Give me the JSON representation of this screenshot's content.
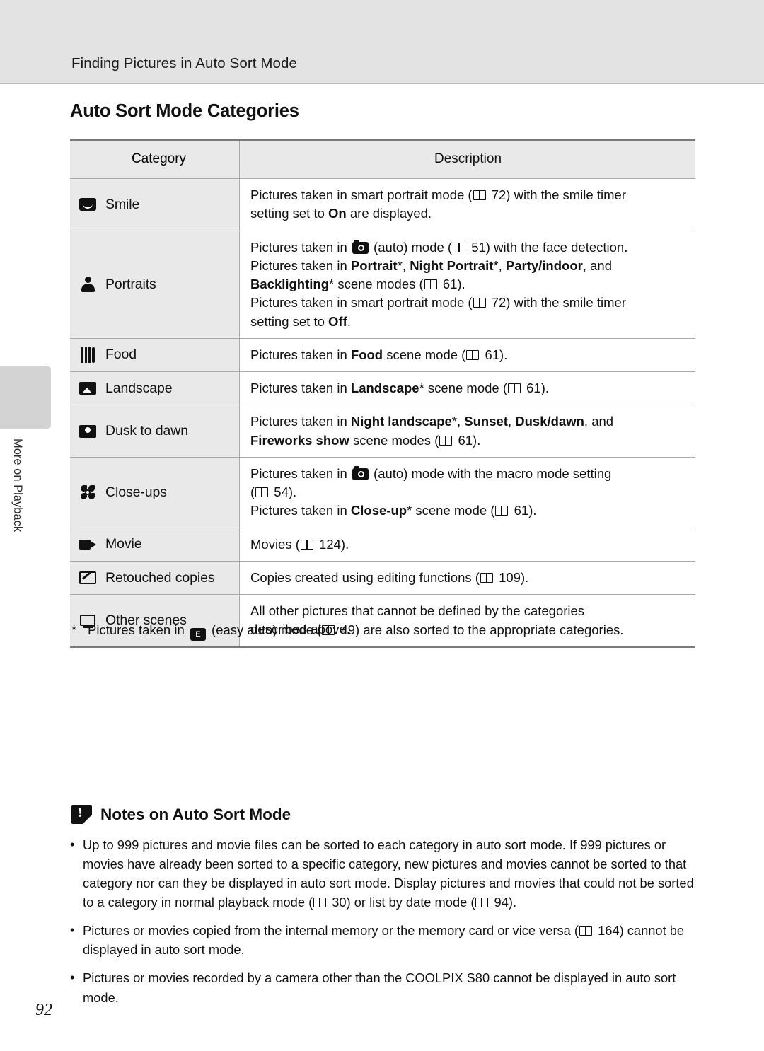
{
  "header": {
    "title": "Finding Pictures in Auto Sort Mode"
  },
  "side_tab": {
    "label": "More on Playback"
  },
  "section": {
    "title": "Auto Sort Mode Categories"
  },
  "table": {
    "headers": {
      "category": "Category",
      "description": "Description"
    },
    "rows": [
      {
        "icon": "smile-icon",
        "category": "Smile",
        "lines": [
          {
            "parts": [
              {
                "t": "Pictures taken in smart portrait mode ("
              },
              {
                "t": "book-icon",
                "type": "icon"
              },
              {
                "t": " 72) with the smile timer"
              }
            ]
          },
          {
            "parts": [
              {
                "t": "setting set to "
              },
              {
                "t": "On",
                "bold": true
              },
              {
                "t": " are displayed."
              }
            ]
          }
        ]
      },
      {
        "icon": "portrait-icon",
        "category": "Portraits",
        "lines": [
          {
            "parts": [
              {
                "t": "Pictures taken in "
              },
              {
                "t": "camera-auto-icon",
                "type": "icon"
              },
              {
                "t": " (auto) mode ("
              },
              {
                "t": "book-icon",
                "type": "icon"
              },
              {
                "t": " 51) with the face detection."
              }
            ]
          },
          {
            "parts": [
              {
                "t": "Pictures taken in "
              },
              {
                "t": "Portrait",
                "bold": true
              },
              {
                "t": "*, "
              },
              {
                "t": "Night Portrait",
                "bold": true
              },
              {
                "t": "*, "
              },
              {
                "t": "Party/indoor",
                "bold": true
              },
              {
                "t": ", and"
              }
            ]
          },
          {
            "parts": [
              {
                "t": "Backlighting",
                "bold": true
              },
              {
                "t": "* scene modes ("
              },
              {
                "t": "book-icon",
                "type": "icon"
              },
              {
                "t": " 61)."
              }
            ]
          },
          {
            "parts": [
              {
                "t": "Pictures taken in smart portrait mode ("
              },
              {
                "t": "book-icon",
                "type": "icon"
              },
              {
                "t": " 72) with the smile timer"
              }
            ]
          },
          {
            "parts": [
              {
                "t": "setting set to "
              },
              {
                "t": "Off",
                "bold": true
              },
              {
                "t": "."
              }
            ]
          }
        ]
      },
      {
        "icon": "food-icon",
        "category": "Food",
        "lines": [
          {
            "parts": [
              {
                "t": "Pictures taken in "
              },
              {
                "t": "Food",
                "bold": true
              },
              {
                "t": " scene mode ("
              },
              {
                "t": "book-icon",
                "type": "icon"
              },
              {
                "t": " 61)."
              }
            ]
          }
        ]
      },
      {
        "icon": "landscape-icon",
        "category": "Landscape",
        "lines": [
          {
            "parts": [
              {
                "t": "Pictures taken in "
              },
              {
                "t": "Landscape",
                "bold": true
              },
              {
                "t": "* scene mode ("
              },
              {
                "t": "book-icon",
                "type": "icon"
              },
              {
                "t": " 61)."
              }
            ]
          }
        ]
      },
      {
        "icon": "dusk-to-dawn-icon",
        "category": "Dusk to dawn",
        "lines": [
          {
            "parts": [
              {
                "t": "Pictures taken in "
              },
              {
                "t": "Night landscape",
                "bold": true
              },
              {
                "t": "*, "
              },
              {
                "t": "Sunset",
                "bold": true
              },
              {
                "t": ", "
              },
              {
                "t": "Dusk/dawn",
                "bold": true
              },
              {
                "t": ", and"
              }
            ]
          },
          {
            "parts": [
              {
                "t": "Fireworks show",
                "bold": true
              },
              {
                "t": " scene modes ("
              },
              {
                "t": "book-icon",
                "type": "icon"
              },
              {
                "t": " 61)."
              }
            ]
          }
        ]
      },
      {
        "icon": "close-ups-icon",
        "category": "Close-ups",
        "lines": [
          {
            "parts": [
              {
                "t": "Pictures taken in "
              },
              {
                "t": "camera-auto-icon",
                "type": "icon"
              },
              {
                "t": " (auto) mode with the macro mode setting"
              }
            ]
          },
          {
            "parts": [
              {
                "t": "("
              },
              {
                "t": "book-icon",
                "type": "icon"
              },
              {
                "t": " 54)."
              }
            ]
          },
          {
            "parts": [
              {
                "t": "Pictures taken in "
              },
              {
                "t": "Close-up",
                "bold": true
              },
              {
                "t": "* scene mode ("
              },
              {
                "t": "book-icon",
                "type": "icon"
              },
              {
                "t": " 61)."
              }
            ]
          }
        ]
      },
      {
        "icon": "movie-icon",
        "category": "Movie",
        "lines": [
          {
            "parts": [
              {
                "t": "Movies ("
              },
              {
                "t": "book-icon",
                "type": "icon"
              },
              {
                "t": " 124)."
              }
            ]
          }
        ]
      },
      {
        "icon": "retouched-copies-icon",
        "category": "Retouched copies",
        "lines": [
          {
            "parts": [
              {
                "t": "Copies created using editing functions ("
              },
              {
                "t": "book-icon",
                "type": "icon"
              },
              {
                "t": " 109)."
              }
            ]
          }
        ]
      },
      {
        "icon": "other-scenes-icon",
        "category": "Other scenes",
        "lines": [
          {
            "parts": [
              {
                "t": "All other pictures that cannot be defined by the categories"
              }
            ]
          },
          {
            "parts": [
              {
                "t": "described above."
              }
            ]
          }
        ]
      }
    ]
  },
  "footnote": {
    "marker": "*",
    "parts": [
      {
        "t": "Pictures taken in "
      },
      {
        "t": "easy-auto-icon",
        "type": "icon"
      },
      {
        "t": " (easy auto) mode ("
      },
      {
        "t": "book-icon",
        "type": "icon"
      },
      {
        "t": " 49) are also sorted to the appropriate categories."
      }
    ]
  },
  "notes": {
    "icon": "caution-icon",
    "title": "Notes on Auto Sort Mode",
    "bullets": [
      {
        "marker": "•",
        "parts": [
          {
            "t": "Up to 999 pictures and movie files can be sorted to each category in auto sort mode. If 999 pictures or movies have already been sorted to a specific category, new pictures and movies cannot be sorted to that category nor can they be displayed in auto sort mode. Display pictures and movies that could not be sorted to a category in normal playback mode ("
          },
          {
            "t": "book-icon",
            "type": "icon"
          },
          {
            "t": " 30) or list by date mode ("
          },
          {
            "t": "book-icon",
            "type": "icon"
          },
          {
            "t": " 94)."
          }
        ]
      },
      {
        "marker": "•",
        "parts": [
          {
            "t": "Pictures or movies copied from the internal memory or the memory card or vice versa ("
          },
          {
            "t": "book-icon",
            "type": "icon"
          },
          {
            "t": " 164) cannot be displayed in auto sort mode."
          }
        ]
      },
      {
        "marker": "•",
        "parts": [
          {
            "t": "Pictures or movies recorded by a camera other than the COOLPIX S80 cannot be displayed in auto sort mode."
          }
        ]
      }
    ]
  },
  "page_number": "92",
  "colors": {
    "header_band": "#e3e3e3",
    "table_header": "#e9e9e9",
    "rule": "#7a7a7a",
    "text": "#111111"
  }
}
